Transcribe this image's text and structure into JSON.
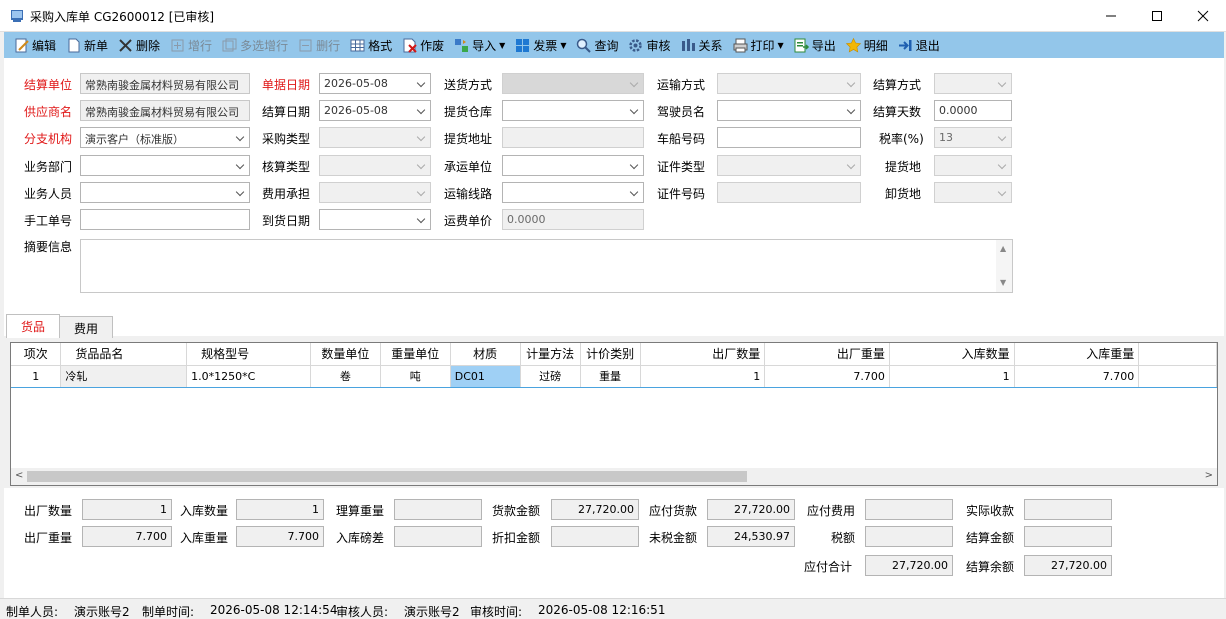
{
  "window": {
    "title": "采购入库单 CG2600012  [已审核]"
  },
  "toolbar": [
    {
      "label": "编辑",
      "icon": "edit-icon",
      "enabled": true
    },
    {
      "label": "新单",
      "icon": "new-document-icon",
      "enabled": true
    },
    {
      "label": "删除",
      "icon": "delete-icon",
      "enabled": true
    },
    {
      "label": "增行",
      "icon": "add-row-icon",
      "enabled": false
    },
    {
      "label": "多选增行",
      "icon": "multi-add-row-icon",
      "enabled": false
    },
    {
      "label": "删行",
      "icon": "delete-row-icon",
      "enabled": false
    },
    {
      "label": "格式",
      "icon": "grid-format-icon",
      "enabled": true
    },
    {
      "label": "作废",
      "icon": "void-icon",
      "enabled": true
    },
    {
      "label": "导入",
      "icon": "import-icon",
      "enabled": true,
      "dropdown": true
    },
    {
      "label": "发票",
      "icon": "invoice-icon",
      "enabled": true,
      "dropdown": true
    },
    {
      "label": "查询",
      "icon": "search-icon",
      "enabled": true
    },
    {
      "label": "审核",
      "icon": "gear-icon",
      "enabled": true
    },
    {
      "label": "关系",
      "icon": "relation-icon",
      "enabled": true
    },
    {
      "label": "打印",
      "icon": "printer-icon",
      "enabled": true,
      "dropdown": true
    },
    {
      "label": "导出",
      "icon": "export-icon",
      "enabled": true
    },
    {
      "label": "明细",
      "icon": "star-icon",
      "enabled": true
    },
    {
      "label": "退出",
      "icon": "exit-icon",
      "enabled": true
    }
  ],
  "form": {
    "settle_unit": {
      "label": "结算单位",
      "value": "常熟南骏金属材料贸易有限公司"
    },
    "supplier": {
      "label": "供应商名",
      "value": "常熟南骏金属材料贸易有限公司"
    },
    "branch": {
      "label": "分支机构",
      "value": "演示客户（标准版）"
    },
    "dept": {
      "label": "业务部门",
      "value": ""
    },
    "staff": {
      "label": "业务人员",
      "value": ""
    },
    "manual_no": {
      "label": "手工单号",
      "value": ""
    },
    "doc_date": {
      "label": "单据日期",
      "value": "2026-05-08"
    },
    "settle_date": {
      "label": "结算日期",
      "value": "2026-05-08"
    },
    "purchase_type": {
      "label": "采购类型",
      "value": ""
    },
    "account_type": {
      "label": "核算类型",
      "value": ""
    },
    "fee_bearer": {
      "label": "费用承担",
      "value": ""
    },
    "arrival_date": {
      "label": "到货日期",
      "value": ""
    },
    "delivery_method": {
      "label": "送货方式",
      "value": ""
    },
    "pickup_warehouse": {
      "label": "提货仓库",
      "value": ""
    },
    "pickup_address": {
      "label": "提货地址",
      "value": ""
    },
    "carrier": {
      "label": "承运单位",
      "value": ""
    },
    "route": {
      "label": "运输线路",
      "value": ""
    },
    "freight_price": {
      "label": "运费单价",
      "value": "0.0000"
    },
    "transport_method": {
      "label": "运输方式",
      "value": ""
    },
    "driver": {
      "label": "驾驶员名",
      "value": ""
    },
    "vehicle_no": {
      "label": "车船号码",
      "value": ""
    },
    "cert_type": {
      "label": "证件类型",
      "value": ""
    },
    "cert_no": {
      "label": "证件号码",
      "value": ""
    },
    "settle_method": {
      "label": "结算方式",
      "value": ""
    },
    "settle_days": {
      "label": "结算天数",
      "value": "0.0000"
    },
    "tax_rate": {
      "label": "税率(%)",
      "value": "13"
    },
    "pickup_place": {
      "label": "提货地",
      "value": ""
    },
    "unload_place": {
      "label": "卸货地",
      "value": ""
    },
    "memo": {
      "label": "摘要信息",
      "value": ""
    }
  },
  "tabs": [
    {
      "label": "货品",
      "active": true
    },
    {
      "label": "费用",
      "active": false
    }
  ],
  "grid": {
    "columns": [
      "项次",
      "货品品名",
      "规格型号",
      "数量单位",
      "重量单位",
      "材质",
      "计量方法",
      "计价类别",
      "出厂数量",
      "出厂重量",
      "入库数量",
      "入库重量"
    ],
    "rows": [
      [
        "1",
        "冷轧",
        "1.0*1250*C",
        "卷",
        "吨",
        "DC01",
        "过磅",
        "重量",
        "1",
        "7.700",
        "1",
        "7.700"
      ]
    ]
  },
  "summary": {
    "out_qty": {
      "label": "出厂数量",
      "value": "1"
    },
    "out_weight": {
      "label": "出厂重量",
      "value": "7.700"
    },
    "in_qty": {
      "label": "入库数量",
      "value": "1"
    },
    "in_weight": {
      "label": "入库重量",
      "value": "7.700"
    },
    "theory_weight": {
      "label": "理算重量",
      "value": ""
    },
    "weigh_diff": {
      "label": "入库磅差",
      "value": ""
    },
    "goods_amount": {
      "label": "货款金额",
      "value": "27,720.00"
    },
    "discount_amount": {
      "label": "折扣金额",
      "value": ""
    },
    "payable_goods": {
      "label": "应付货款",
      "value": "27,720.00"
    },
    "untaxed_amount": {
      "label": "未税金额",
      "value": "24,530.97"
    },
    "payable_fee": {
      "label": "应付费用",
      "value": ""
    },
    "tax": {
      "label": "税额",
      "value": ""
    },
    "payable_total": {
      "label": "应付合计",
      "value": "27,720.00"
    },
    "actual_received": {
      "label": "实际收款",
      "value": ""
    },
    "settle_amount": {
      "label": "结算金额",
      "value": ""
    },
    "settle_balance": {
      "label": "结算余额",
      "value": "27,720.00"
    }
  },
  "status": {
    "creator_label": "制单人员:",
    "creator": "演示账号2",
    "created_label": "制单时间:",
    "created": "2026-05-08 12:14:54",
    "auditor_label": "审核人员:",
    "auditor": "演示账号2",
    "audited_label": "审核时间:",
    "audited": "2026-05-08 12:16:51"
  },
  "colors": {
    "toolbar_bg": "#93c6ea",
    "required_label": "#e01818",
    "grid_highlight": "#4aa3df"
  }
}
